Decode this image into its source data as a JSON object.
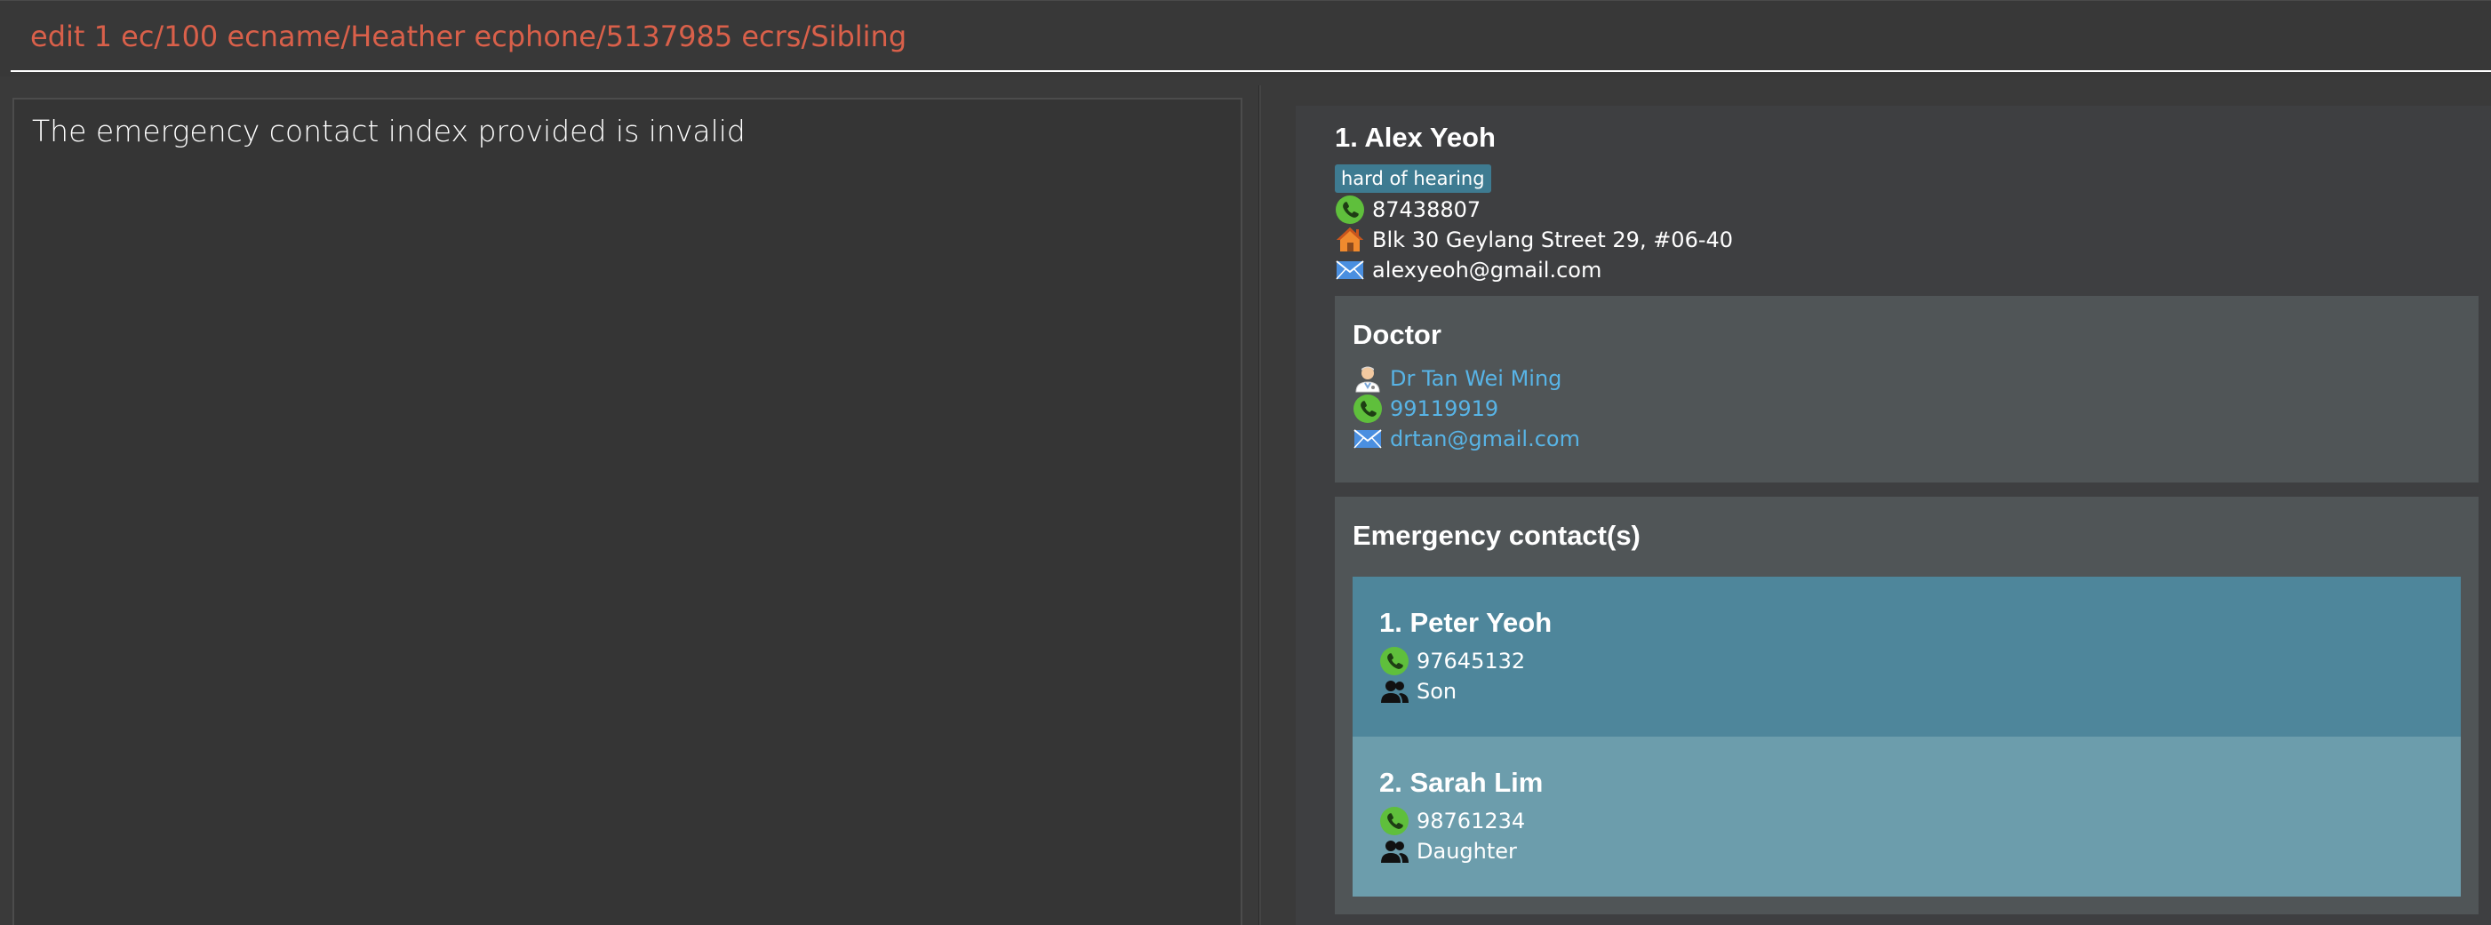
{
  "command": {
    "value": "edit 1 ec/100 ecname/Heather ecphone/5137985 ecrs/Sibling"
  },
  "result": {
    "message": "The emergency contact index provided is invalid"
  },
  "person": {
    "index_name": "1. Alex Yeoh",
    "tags": [
      "hard of hearing"
    ],
    "phone": "87438807",
    "address": "Blk 30 Geylang Street 29, #06-40",
    "email": "alexyeoh@gmail.com",
    "icons": {
      "phone": "phone-icon",
      "address": "house-icon",
      "email": "envelope-icon"
    },
    "doctor": {
      "heading": "Doctor",
      "name": "Dr Tan Wei Ming",
      "phone": "99119919",
      "email": "drtan@gmail.com",
      "icons": {
        "name": "doctor-icon",
        "phone": "phone-icon",
        "email": "envelope-icon"
      }
    },
    "emergency_contacts": {
      "heading": "Emergency contact(s)",
      "items": [
        {
          "index_name": "1. Peter Yeoh",
          "phone": "97645132",
          "relationship": "Son"
        },
        {
          "index_name": "2. Sarah Lim",
          "phone": "98761234",
          "relationship": "Daughter"
        }
      ]
    }
  },
  "colors": {
    "background": "#3a3a3a",
    "command_text": "#d9604a",
    "tag_bg": "#3e7b91",
    "doctor_text": "#58b4e6",
    "ec_card_1": "#4e869b",
    "ec_card_2": "#6c9dac"
  }
}
